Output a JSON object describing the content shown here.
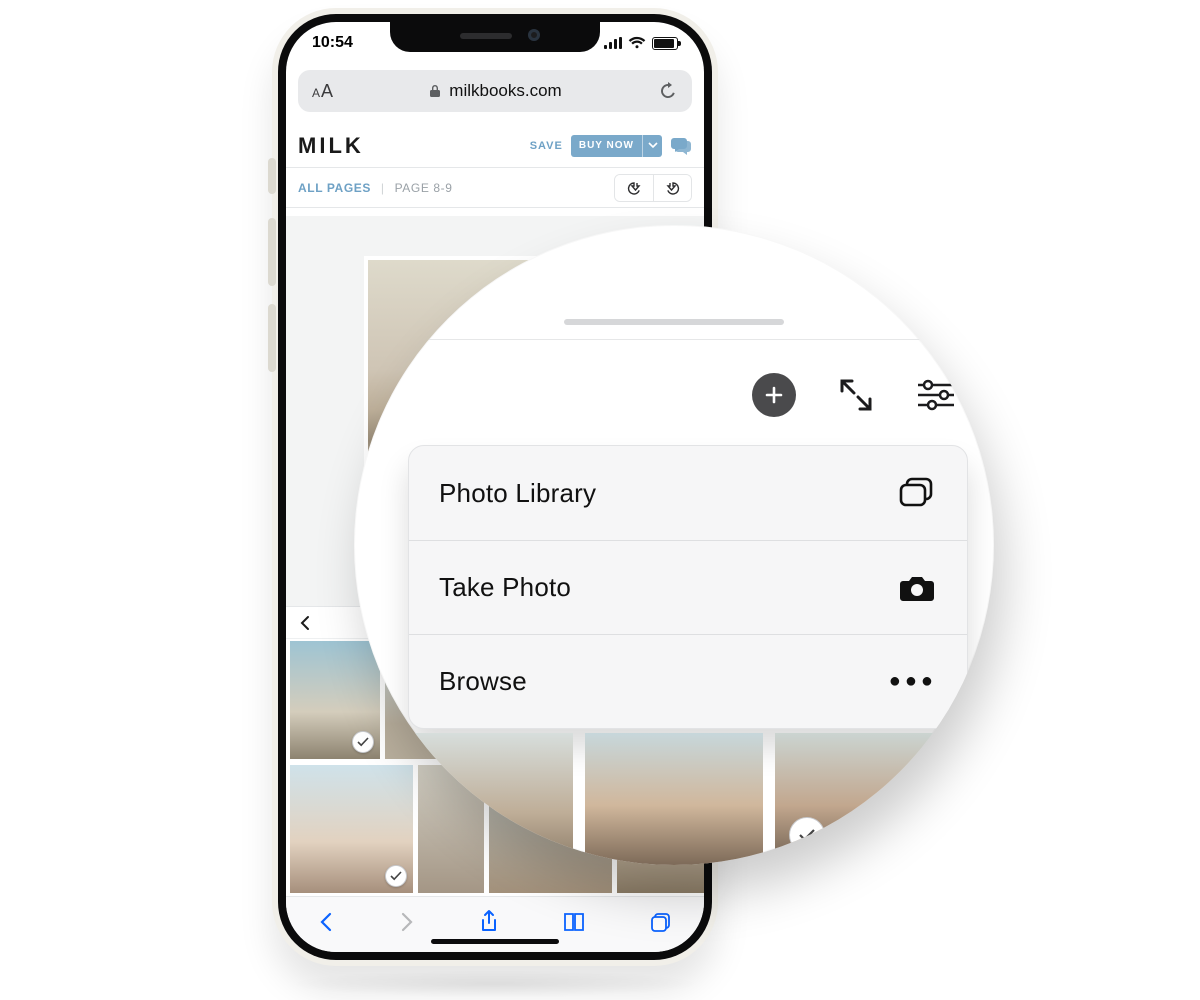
{
  "status_bar": {
    "time": "10:54"
  },
  "browser": {
    "domain": "milkbooks.com"
  },
  "site": {
    "logo": "MILK",
    "save_label": "SAVE",
    "buy_label": "BUY NOW"
  },
  "breadcrumb": {
    "all_pages": "ALL PAGES",
    "current": "PAGE 8-9"
  },
  "action_sheet": {
    "items": [
      {
        "label": "Photo Library",
        "icon": "stack-icon"
      },
      {
        "label": "Take Photo",
        "icon": "camera-icon"
      },
      {
        "label": "Browse",
        "icon": "more-icon"
      }
    ]
  }
}
